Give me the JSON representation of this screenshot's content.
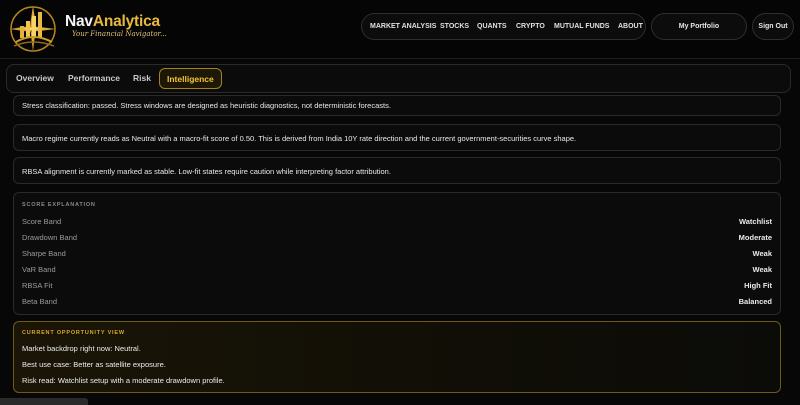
{
  "header": {
    "brand_prefix": "Nav",
    "brand_suffix": "Analytica",
    "tagline": "Your Financial Navigator...",
    "nav": [
      "MARKET ANALYSIS",
      "STOCKS",
      "QUANTS",
      "CRYPTO",
      "MUTUAL FUNDS",
      "ABOUT"
    ],
    "portfolio_label": "My Portfolio",
    "signout_label": "Sign Out"
  },
  "tabs": {
    "items": [
      "Overview",
      "Performance",
      "Risk",
      "Intelligence"
    ],
    "active": "Intelligence"
  },
  "notes": [
    "Stress classification: passed. Stress windows are designed as heuristic diagnostics, not deterministic forecasts.",
    "Macro regime currently reads as Neutral with a macro-fit score of 0.50. This is derived from India 10Y rate direction and the current government-securities curve shape.",
    "RBSA alignment is currently marked as stable. Low-fit states require caution while interpreting factor attribution."
  ],
  "score_explanation": {
    "title": "SCORE EXPLANATION",
    "rows": [
      {
        "label": "Score Band",
        "value": "Watchlist"
      },
      {
        "label": "Drawdown Band",
        "value": "Moderate"
      },
      {
        "label": "Sharpe Band",
        "value": "Weak"
      },
      {
        "label": "VaR Band",
        "value": "Weak"
      },
      {
        "label": "RBSA Fit",
        "value": "High Fit"
      },
      {
        "label": "Beta Band",
        "value": "Balanced"
      }
    ]
  },
  "opportunity": {
    "title": "CURRENT OPPORTUNITY VIEW",
    "lines": [
      "Market backdrop right now: Neutral.",
      "Best use case: Better as satellite exposure.",
      "Risk read: Watchlist setup with a moderate drawdown profile."
    ]
  },
  "colors": {
    "accent_gold": "#e8b93a",
    "background": "#070707"
  }
}
